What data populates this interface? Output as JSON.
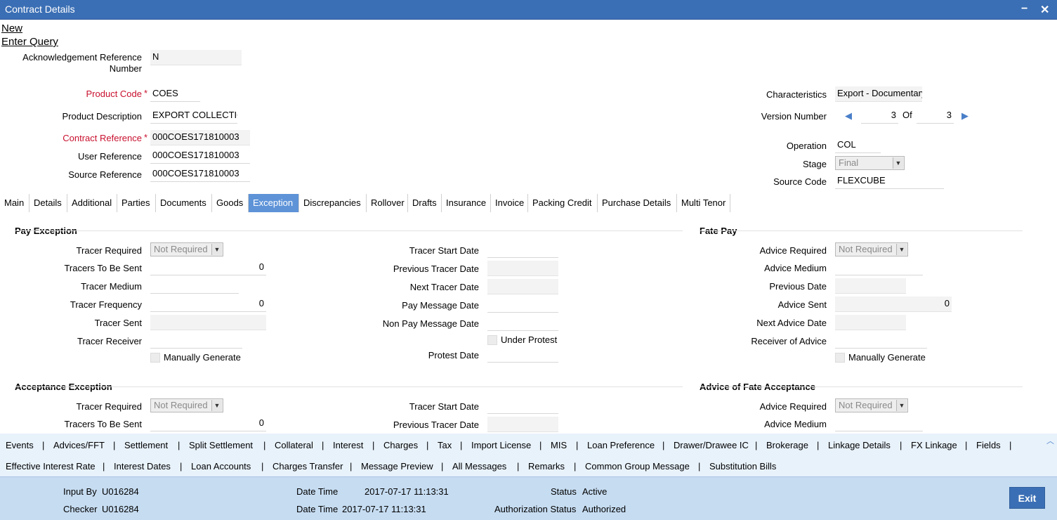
{
  "window": {
    "title": "Contract Details",
    "minimize": "−",
    "close": "✕"
  },
  "actions": {
    "new": "New",
    "enter_query": "Enter Query"
  },
  "header": {
    "ack_ref_label": "Acknowledgement Reference Number",
    "ack_ref_value": "N",
    "product_code_label": "Product Code",
    "product_code_value": "COES",
    "product_desc_label": "Product Description",
    "product_desc_value": "EXPORT COLLECTION",
    "contract_ref_label": "Contract Reference",
    "contract_ref_value": "000COES171810003",
    "user_ref_label": "User Reference",
    "user_ref_value": "000COES171810003",
    "source_ref_label": "Source Reference",
    "source_ref_value": "000COES171810003",
    "characteristics_label": "Characteristics",
    "characteristics_value": "Export  - Documentary",
    "version_label": "Version Number",
    "version_current": "3",
    "version_of": "Of",
    "version_total": "3",
    "operation_label": "Operation",
    "operation_value": "COL",
    "stage_label": "Stage",
    "stage_value": "Final",
    "source_code_label": "Source Code",
    "source_code_value": "FLEXCUBE",
    "required_mark": "*"
  },
  "tabs": [
    "Main",
    "Details",
    "Additional",
    "Parties",
    "Documents",
    "Goods",
    "Exception",
    "Discrepancies",
    "Rollover",
    "Drafts",
    "Insurance",
    "Invoice",
    "Packing Credit",
    "Purchase Details",
    "Multi Tenor"
  ],
  "active_tab": "Exception",
  "pay_exception": {
    "title": "Pay Exception",
    "tracer_required_label": "Tracer Required",
    "tracer_required_value": "Not Required",
    "tracers_to_be_sent_label": "Tracers To Be Sent",
    "tracers_to_be_sent_value": "0",
    "tracer_medium_label": "Tracer Medium",
    "tracer_frequency_label": "Tracer Frequency",
    "tracer_frequency_value": "0",
    "tracer_sent_label": "Tracer Sent",
    "tracer_receiver_label": "Tracer Receiver",
    "manually_generate_label": "Manually Generate",
    "tracer_start_date_label": "Tracer Start Date",
    "previous_tracer_date_label": "Previous Tracer Date",
    "next_tracer_date_label": "Next Tracer Date",
    "pay_message_date_label": "Pay Message Date",
    "non_pay_message_date_label": "Non Pay Message Date",
    "under_protest_label": "Under Protest",
    "protest_date_label": "Protest Date"
  },
  "fate_pay": {
    "title": "Fate Pay",
    "advice_required_label": "Advice Required",
    "advice_required_value": "Not Required",
    "advice_medium_label": "Advice Medium",
    "previous_date_label": "Previous Date",
    "advice_sent_label": "Advice Sent",
    "advice_sent_value": "0",
    "next_advice_date_label": "Next Advice Date",
    "receiver_of_advice_label": "Receiver of Advice",
    "manually_generate_label": "Manually Generate"
  },
  "acceptance_exception": {
    "title": "Acceptance Exception",
    "tracer_required_label": "Tracer Required",
    "tracer_required_value": "Not Required",
    "tracers_to_be_sent_label": "Tracers To Be Sent",
    "tracers_to_be_sent_value": "0",
    "tracer_start_date_label": "Tracer Start Date",
    "previous_tracer_date_label": "Previous Tracer Date"
  },
  "advice_fate_acceptance": {
    "title": "Advice of Fate Acceptance",
    "advice_required_label": "Advice Required",
    "advice_required_value": "Not Required",
    "advice_medium_label": "Advice Medium"
  },
  "bottom_buttons_row1": [
    "Events",
    "Advices/FFT",
    "Settlement",
    "Split Settlement",
    "Collateral",
    "Interest",
    "Charges",
    "Tax",
    "Import License",
    "MIS",
    "Loan Preference",
    "Drawer/Drawee IC",
    "Brokerage",
    "Linkage Details",
    "FX Linkage",
    "Fields"
  ],
  "bottom_buttons_row2": [
    "Effective Interest Rate",
    "Interest Dates",
    "Loan Accounts",
    "Charges Transfer",
    "Message Preview",
    "All Messages",
    "Remarks",
    "Common Group Message",
    "Substitution Bills"
  ],
  "separator": "|",
  "footer": {
    "input_by_label": "Input By",
    "input_by_value": "U016284",
    "checker_label": "Checker",
    "checker_value": "U016284",
    "date_time_label": "Date Time",
    "input_date_time": "2017-07-17 11:13:31",
    "checker_date_time": "2017-07-17 11:13:31",
    "status_label": "Status",
    "status_value": "Active",
    "auth_status_label": "Authorization Status",
    "auth_status_value": "Authorized",
    "exit_label": "Exit"
  }
}
